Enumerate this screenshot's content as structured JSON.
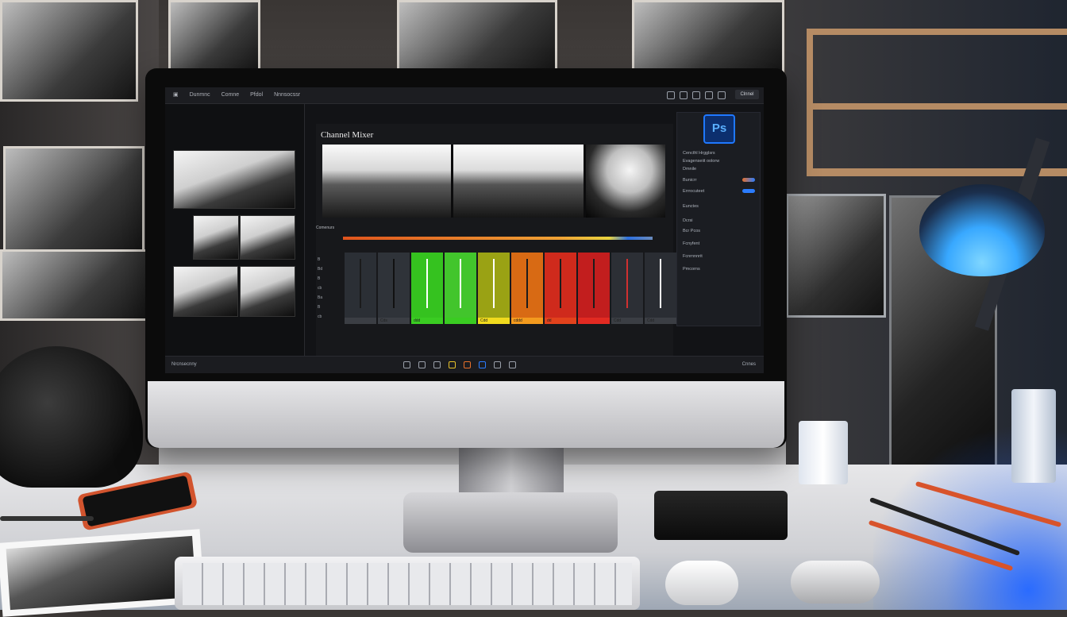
{
  "scene": {
    "description_type": "photo of a desk with an iMac-style monitor showing a photo editing app"
  },
  "app": {
    "menu": [
      "Dunmnc",
      "Comne",
      "Pfdol",
      "Nnnsocssr"
    ],
    "topbar_button": "Clnnel",
    "panel_title": "Channel Mixer",
    "mixer_label": "Comenurs",
    "row_labels": [
      "B",
      "Bd",
      "B",
      "cb",
      "Ba",
      "B",
      "cb",
      "B"
    ],
    "channels": [
      {
        "color": "#2b2f35",
        "stem": "#1b1b1b",
        "foot": "#3b3e44",
        "label": ""
      },
      {
        "color": "#2f3339",
        "stem": "#111111",
        "foot": "#3b3e44",
        "label": "Cds"
      },
      {
        "color": "#35c21f",
        "stem": "#ffffff",
        "foot": "#3acc22",
        "label": "ddd"
      },
      {
        "color": "#42c52c",
        "stem": "#ffffff",
        "foot": "#3acc22",
        "label": ""
      },
      {
        "color": "#9aa214",
        "stem": "#ffffff",
        "foot": "#f0da1e",
        "label": "Cdd"
      },
      {
        "color": "#d86a14",
        "stem": "#1b1b1b",
        "foot": "#f39a1e",
        "label": "cddd"
      },
      {
        "color": "#cf2a1c",
        "stem": "#1b1b1b",
        "foot": "#e2421c",
        "label": "dd"
      },
      {
        "color": "#c21e1e",
        "stem": "#1b1b1b",
        "foot": "#e22a22",
        "label": ""
      },
      {
        "color": "#2c2f35",
        "stem": "#d03030",
        "foot": "#3b3e44",
        "label": "Cdd"
      },
      {
        "color": "#2a2d33",
        "stem": "#ffffff",
        "foot": "#3b3e44",
        "label": "Cdd"
      }
    ],
    "right_panel": {
      "logo": "Ps",
      "rows": [
        "Cencthl Hrgglsrs",
        "Evagenseiit oolorw",
        "Dmnile",
        "Bunicrr",
        "Errrocuteet",
        "Eunctes",
        "Dcrsi",
        "Bcr Pcos",
        "Fcnyfent",
        "Fcnrnnnrit",
        "Pmcorns"
      ]
    },
    "status_left": "Nrcnsecnny",
    "status_right": "Cnnes"
  },
  "colors": {
    "accent_blue": "#1f78ff",
    "lamp_glow": "#38a8ff"
  }
}
